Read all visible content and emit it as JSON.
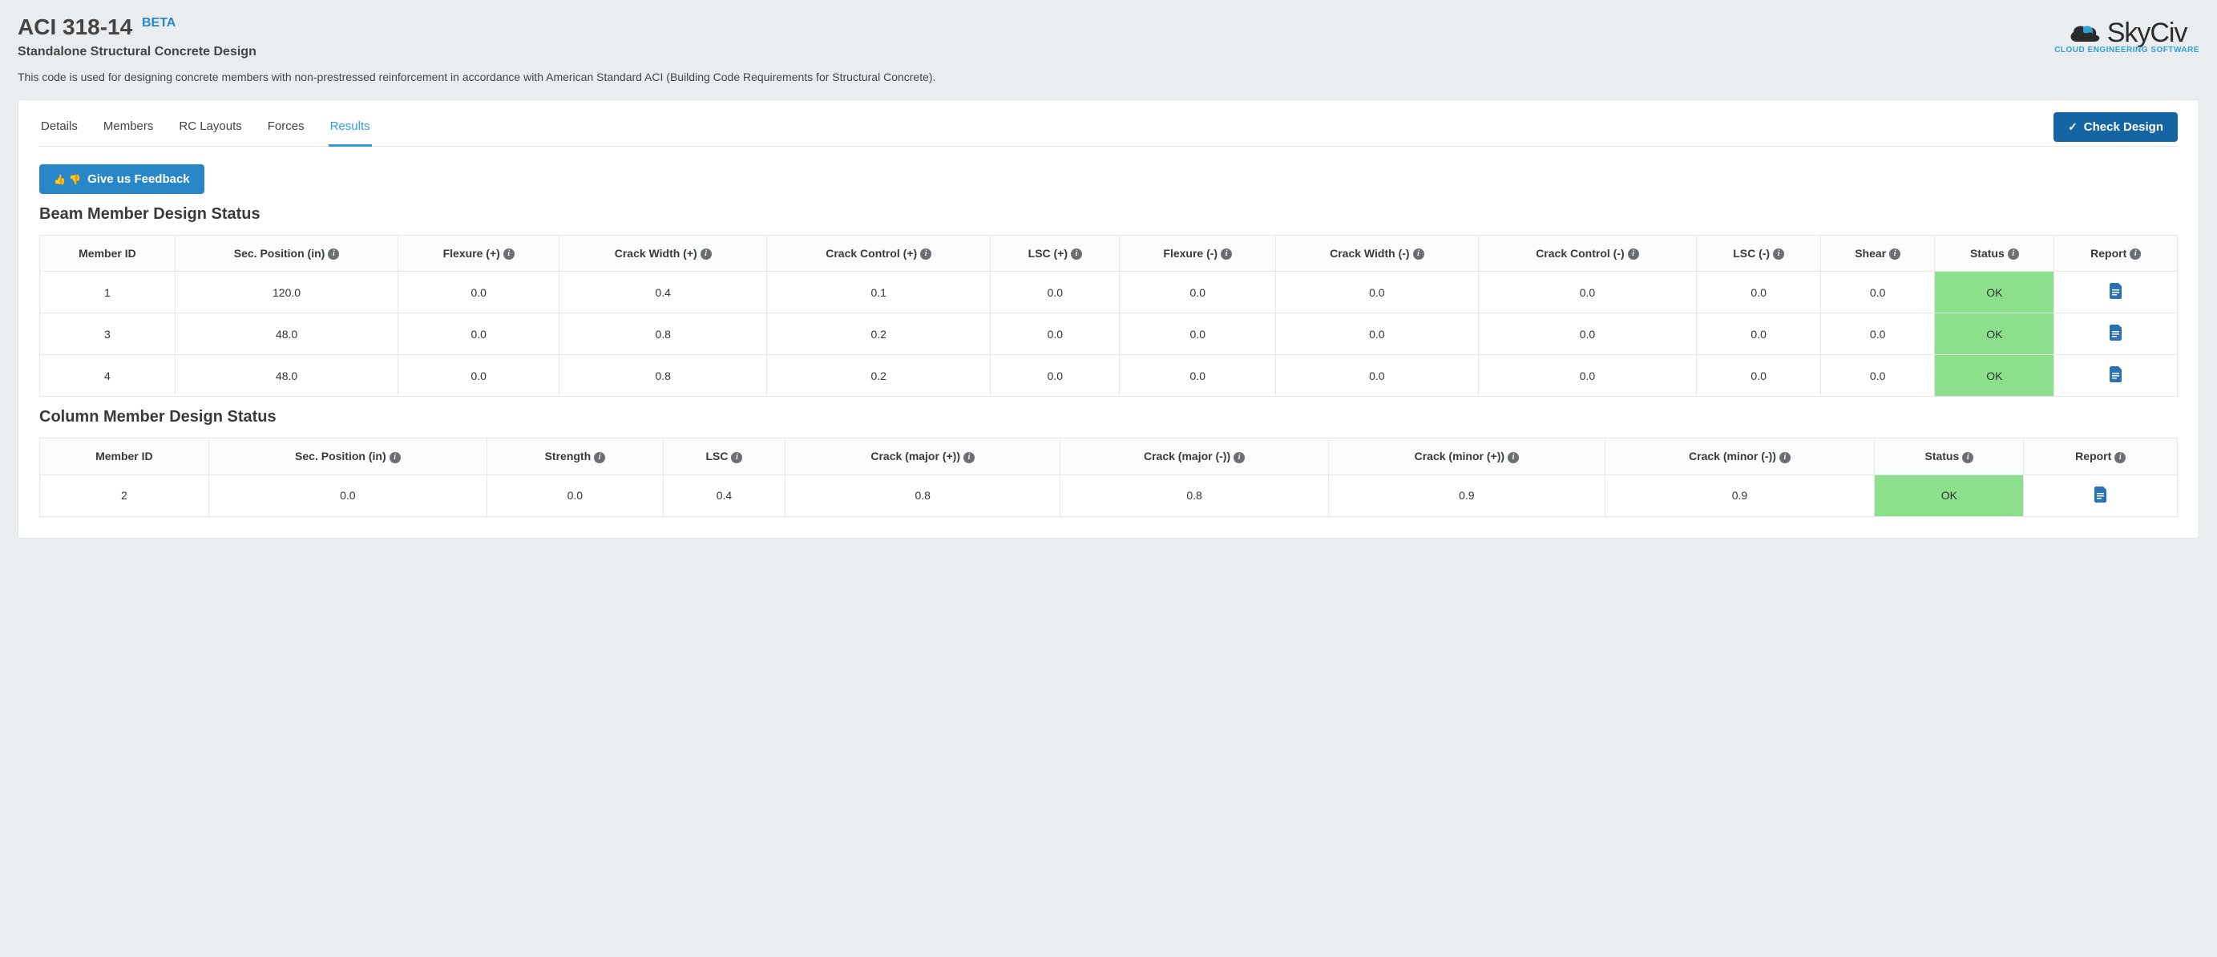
{
  "header": {
    "title": "ACI 318-14",
    "beta": "BETA",
    "subtitle": "Standalone Structural Concrete Design",
    "description": "This code is used for designing concrete members with non-prestressed reinforcement in accordance with American Standard ACI (Building Code Requirements for Structural Concrete).",
    "logo_text": "SkyCiv",
    "logo_sub": "CLOUD ENGINEERING SOFTWARE"
  },
  "tabs": {
    "details": "Details",
    "members": "Members",
    "rc_layouts": "RC Layouts",
    "forces": "Forces",
    "results": "Results"
  },
  "buttons": {
    "check_design": "Check Design",
    "feedback": "Give us Feedback"
  },
  "sections": {
    "beam_title": "Beam Member Design Status",
    "column_title": "Column Member Design Status"
  },
  "beam_headers": {
    "member_id": "Member ID",
    "sec_position": "Sec. Position (in)",
    "flexure_pos": "Flexure (+)",
    "crack_width_pos": "Crack Width (+)",
    "crack_control_pos": "Crack Control (+)",
    "lsc_pos": "LSC (+)",
    "flexure_neg": "Flexure (-)",
    "crack_width_neg": "Crack Width (-)",
    "crack_control_neg": "Crack Control (-)",
    "lsc_neg": "LSC (-)",
    "shear": "Shear",
    "status": "Status",
    "report": "Report"
  },
  "beam_rows": [
    {
      "member_id": "1",
      "sec_position": "120.0",
      "flexure_pos": "0.0",
      "crack_width_pos": "0.4",
      "crack_control_pos": "0.1",
      "lsc_pos": "0.0",
      "flexure_neg": "0.0",
      "crack_width_neg": "0.0",
      "crack_control_neg": "0.0",
      "lsc_neg": "0.0",
      "shear": "0.0",
      "status": "OK"
    },
    {
      "member_id": "3",
      "sec_position": "48.0",
      "flexure_pos": "0.0",
      "crack_width_pos": "0.8",
      "crack_control_pos": "0.2",
      "lsc_pos": "0.0",
      "flexure_neg": "0.0",
      "crack_width_neg": "0.0",
      "crack_control_neg": "0.0",
      "lsc_neg": "0.0",
      "shear": "0.0",
      "status": "OK"
    },
    {
      "member_id": "4",
      "sec_position": "48.0",
      "flexure_pos": "0.0",
      "crack_width_pos": "0.8",
      "crack_control_pos": "0.2",
      "lsc_pos": "0.0",
      "flexure_neg": "0.0",
      "crack_width_neg": "0.0",
      "crack_control_neg": "0.0",
      "lsc_neg": "0.0",
      "shear": "0.0",
      "status": "OK"
    }
  ],
  "column_headers": {
    "member_id": "Member ID",
    "sec_position": "Sec. Position (in)",
    "strength": "Strength",
    "lsc": "LSC",
    "crack_major_pos": "Crack (major (+))",
    "crack_major_neg": "Crack (major (-))",
    "crack_minor_pos": "Crack (minor (+))",
    "crack_minor_neg": "Crack (minor (-))",
    "status": "Status",
    "report": "Report"
  },
  "column_rows": [
    {
      "member_id": "2",
      "sec_position": "0.0",
      "strength": "0.0",
      "lsc": "0.4",
      "crack_major_pos": "0.8",
      "crack_major_neg": "0.8",
      "crack_minor_pos": "0.9",
      "crack_minor_neg": "0.9",
      "status": "OK"
    }
  ]
}
